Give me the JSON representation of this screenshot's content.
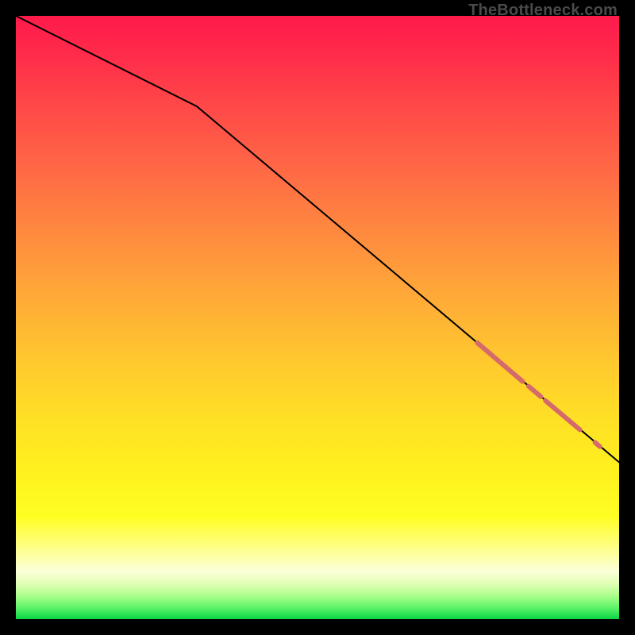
{
  "attribution": "TheBottleneck.com",
  "chart_data": {
    "type": "line",
    "title": "",
    "xlabel": "",
    "ylabel": "",
    "xlim": [
      0,
      100
    ],
    "ylim": [
      0,
      100
    ],
    "grid": false,
    "legend": false,
    "series": [
      {
        "name": "curve",
        "x": [
          0,
          30,
          100
        ],
        "y": [
          100,
          85,
          26
        ],
        "stroke": "#000000",
        "width": 2
      }
    ],
    "highlights": [
      {
        "name": "segment-a",
        "x0": 76.5,
        "y0": 45.8,
        "x1": 84.0,
        "y1": 39.4,
        "stroke": "#d46a6a",
        "width": 6
      },
      {
        "name": "segment-b",
        "x0": 85.0,
        "y0": 38.6,
        "x1": 87.0,
        "y1": 36.9,
        "stroke": "#d46a6a",
        "width": 6
      },
      {
        "name": "segment-c",
        "x0": 87.8,
        "y0": 36.2,
        "x1": 93.5,
        "y1": 31.4,
        "stroke": "#d46a6a",
        "width": 6
      },
      {
        "name": "dot-d",
        "x0": 96.0,
        "y0": 29.3,
        "x1": 96.8,
        "y1": 28.6,
        "stroke": "#d46a6a",
        "width": 6
      }
    ],
    "background_gradient": {
      "top": "#ff1a4c",
      "mid": "#ffde26",
      "bottom": "#0ad645"
    }
  }
}
